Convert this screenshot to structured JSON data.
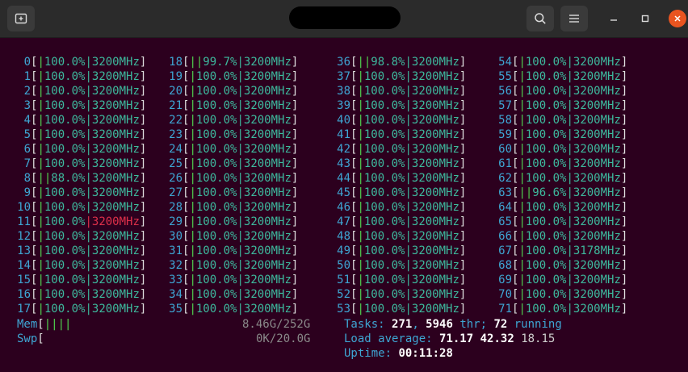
{
  "titlebar": {
    "new_tab_icon": "new-tab-icon",
    "search_icon": "search-icon",
    "menu_icon": "hamburger-icon",
    "minimize_icon": "minimize-icon",
    "maximize_icon": "maximize-icon",
    "close_icon": "close-icon",
    "close_color": "#e95420"
  },
  "cpus": [
    {
      "id": "0",
      "bar": "|",
      "val": "100.0%",
      "freq": "3200MHz"
    },
    {
      "id": "1",
      "bar": "|",
      "val": "100.0%",
      "freq": "3200MHz"
    },
    {
      "id": "2",
      "bar": "|",
      "val": "100.0%",
      "freq": "3200MHz"
    },
    {
      "id": "3",
      "bar": "|",
      "val": "100.0%",
      "freq": "3200MHz"
    },
    {
      "id": "4",
      "bar": "|",
      "val": "100.0%",
      "freq": "3200MHz"
    },
    {
      "id": "5",
      "bar": "|",
      "val": "100.0%",
      "freq": "3200MHz"
    },
    {
      "id": "6",
      "bar": "|",
      "val": "100.0%",
      "freq": "3200MHz"
    },
    {
      "id": "7",
      "bar": "|",
      "val": "100.0%",
      "freq": "3200MHz"
    },
    {
      "id": "8",
      "bar": "||",
      "val": "88.0%",
      "freq": "3200MHz"
    },
    {
      "id": "9",
      "bar": "|",
      "val": "100.0%",
      "freq": "3200MHz"
    },
    {
      "id": "10",
      "bar": "|",
      "val": "100.0%",
      "freq": "3200MHz"
    },
    {
      "id": "11",
      "bar": "|",
      "val": "100.0%",
      "freq": "3200MHz"
    },
    {
      "id": "12",
      "bar": "|",
      "val": "100.0%",
      "freq": "3200MHz"
    },
    {
      "id": "13",
      "bar": "|",
      "val": "100.0%",
      "freq": "3200MHz"
    },
    {
      "id": "14",
      "bar": "|",
      "val": "100.0%",
      "freq": "3200MHz"
    },
    {
      "id": "15",
      "bar": "|",
      "val": "100.0%",
      "freq": "3200MHz"
    },
    {
      "id": "16",
      "bar": "|",
      "val": "100.0%",
      "freq": "3200MHz"
    },
    {
      "id": "17",
      "bar": "|",
      "val": "100.0%",
      "freq": "3200MHz"
    },
    {
      "id": "18",
      "bar": "||",
      "val": "99.7%",
      "freq": "3200MHz"
    },
    {
      "id": "19",
      "bar": "|",
      "val": "100.0%",
      "freq": "3200MHz"
    },
    {
      "id": "20",
      "bar": "|",
      "val": "100.0%",
      "freq": "3200MHz"
    },
    {
      "id": "21",
      "bar": "|",
      "val": "100.0%",
      "freq": "3200MHz"
    },
    {
      "id": "22",
      "bar": "|",
      "val": "100.0%",
      "freq": "3200MHz"
    },
    {
      "id": "23",
      "bar": "|",
      "val": "100.0%",
      "freq": "3200MHz"
    },
    {
      "id": "24",
      "bar": "|",
      "val": "100.0%",
      "freq": "3200MHz"
    },
    {
      "id": "25",
      "bar": "|",
      "val": "100.0%",
      "freq": "3200MHz"
    },
    {
      "id": "26",
      "bar": "|",
      "val": "100.0%",
      "freq": "3200MHz"
    },
    {
      "id": "27",
      "bar": "|",
      "val": "100.0%",
      "freq": "3200MHz"
    },
    {
      "id": "28",
      "bar": "|",
      "val": "100.0%",
      "freq": "3200MHz"
    },
    {
      "id": "29",
      "bar": "|",
      "val": "100.0%",
      "freq": "3200MHz"
    },
    {
      "id": "30",
      "bar": "|",
      "val": "100.0%",
      "freq": "3200MHz"
    },
    {
      "id": "31",
      "bar": "|",
      "val": "100.0%",
      "freq": "3200MHz"
    },
    {
      "id": "32",
      "bar": "|",
      "val": "100.0%",
      "freq": "3200MHz"
    },
    {
      "id": "33",
      "bar": "|",
      "val": "100.0%",
      "freq": "3200MHz"
    },
    {
      "id": "34",
      "bar": "|",
      "val": "100.0%",
      "freq": "3200MHz"
    },
    {
      "id": "35",
      "bar": "|",
      "val": "100.0%",
      "freq": "3200MHz"
    },
    {
      "id": "36",
      "bar": "||",
      "val": "98.8%",
      "freq": "3200MHz"
    },
    {
      "id": "37",
      "bar": "|",
      "val": "100.0%",
      "freq": "3200MHz"
    },
    {
      "id": "38",
      "bar": "|",
      "val": "100.0%",
      "freq": "3200MHz"
    },
    {
      "id": "39",
      "bar": "|",
      "val": "100.0%",
      "freq": "3200MHz"
    },
    {
      "id": "40",
      "bar": "|",
      "val": "100.0%",
      "freq": "3200MHz"
    },
    {
      "id": "41",
      "bar": "|",
      "val": "100.0%",
      "freq": "3200MHz"
    },
    {
      "id": "42",
      "bar": "|",
      "val": "100.0%",
      "freq": "3200MHz"
    },
    {
      "id": "43",
      "bar": "|",
      "val": "100.0%",
      "freq": "3200MHz"
    },
    {
      "id": "44",
      "bar": "|",
      "val": "100.0%",
      "freq": "3200MHz"
    },
    {
      "id": "45",
      "bar": "|",
      "val": "100.0%",
      "freq": "3200MHz"
    },
    {
      "id": "46",
      "bar": "|",
      "val": "100.0%",
      "freq": "3200MHz"
    },
    {
      "id": "47",
      "bar": "|",
      "val": "100.0%",
      "freq": "3200MHz"
    },
    {
      "id": "48",
      "bar": "|",
      "val": "100.0%",
      "freq": "3200MHz"
    },
    {
      "id": "49",
      "bar": "|",
      "val": "100.0%",
      "freq": "3200MHz"
    },
    {
      "id": "50",
      "bar": "|",
      "val": "100.0%",
      "freq": "3200MHz"
    },
    {
      "id": "51",
      "bar": "|",
      "val": "100.0%",
      "freq": "3200MHz"
    },
    {
      "id": "52",
      "bar": "|",
      "val": "100.0%",
      "freq": "3200MHz"
    },
    {
      "id": "53",
      "bar": "|",
      "val": "100.0%",
      "freq": "3200MHz"
    },
    {
      "id": "54",
      "bar": "|",
      "val": "100.0%",
      "freq": "3200MHz"
    },
    {
      "id": "55",
      "bar": "|",
      "val": "100.0%",
      "freq": "3200MHz"
    },
    {
      "id": "56",
      "bar": "|",
      "val": "100.0%",
      "freq": "3200MHz"
    },
    {
      "id": "57",
      "bar": "|",
      "val": "100.0%",
      "freq": "3200MHz"
    },
    {
      "id": "58",
      "bar": "|",
      "val": "100.0%",
      "freq": "3200MHz"
    },
    {
      "id": "59",
      "bar": "|",
      "val": "100.0%",
      "freq": "3200MHz"
    },
    {
      "id": "60",
      "bar": "|",
      "val": "100.0%",
      "freq": "3200MHz"
    },
    {
      "id": "61",
      "bar": "|",
      "val": "100.0%",
      "freq": "3200MHz"
    },
    {
      "id": "62",
      "bar": "|",
      "val": "100.0%",
      "freq": "3200MHz"
    },
    {
      "id": "63",
      "bar": "||",
      "val": "96.6%",
      "freq": "3200MHz"
    },
    {
      "id": "64",
      "bar": "|",
      "val": "100.0%",
      "freq": "3200MHz"
    },
    {
      "id": "65",
      "bar": "|",
      "val": "100.0%",
      "freq": "3200MHz"
    },
    {
      "id": "66",
      "bar": "|",
      "val": "100.0%",
      "freq": "3200MHz"
    },
    {
      "id": "67",
      "bar": "|",
      "val": "100.0%",
      "freq": "3178MHz"
    },
    {
      "id": "68",
      "bar": "|",
      "val": "100.0%",
      "freq": "3200MHz"
    },
    {
      "id": "69",
      "bar": "|",
      "val": "100.0%",
      "freq": "3200MHz"
    },
    {
      "id": "70",
      "bar": "|",
      "val": "100.0%",
      "freq": "3200MHz"
    },
    {
      "id": "71",
      "bar": "|",
      "val": "100.0%",
      "freq": "3200MHz"
    }
  ],
  "mem": {
    "label": "Mem",
    "bars": "||||",
    "value": "8.46G/252G"
  },
  "swp": {
    "label": "Swp",
    "value": "0K/20.0G"
  },
  "tasks": {
    "label": "Tasks: ",
    "count": "271",
    "sep": ", ",
    "threads": "5946",
    "thr_label": " thr; ",
    "running": "72",
    "running_label": " running"
  },
  "load": {
    "label": "Load average: ",
    "l1": "71.17",
    "l5": "42.32",
    "l15": "18.15"
  },
  "uptime": {
    "label": "Uptime: ",
    "value": "00:11:28"
  },
  "colors": {
    "bg": "#2c001e",
    "label": "#3ea6d4",
    "bar_green": "#4fd24f",
    "bar_blue": "#4a7bd6",
    "value": "#3dba9e",
    "highlight": "#e0304a"
  }
}
